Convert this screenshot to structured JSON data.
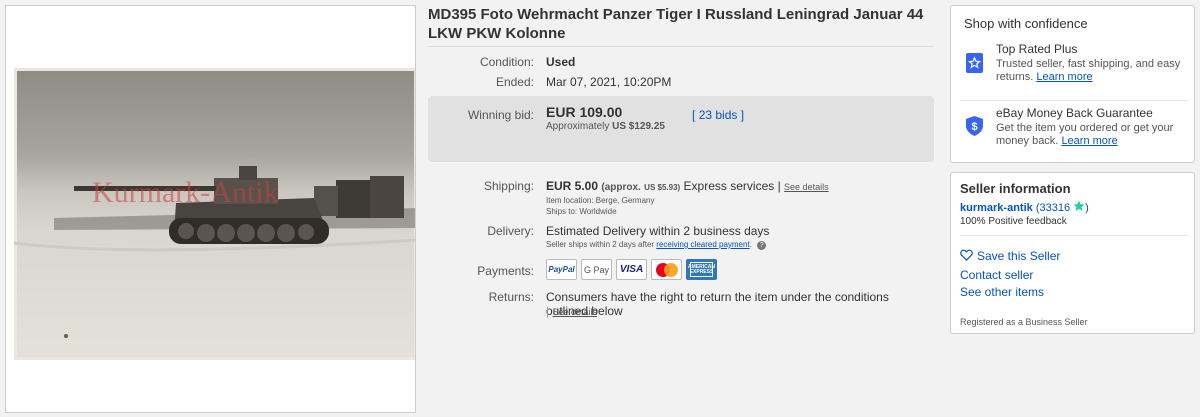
{
  "listing": {
    "title": "MD395 Foto Wehrmacht Panzer Tiger I Russland Leningrad Januar 44 LKW PKW Kolonne",
    "watermark": "Kurmark-Antik"
  },
  "details": {
    "condition_label": "Condition:",
    "condition_value": "Used",
    "ended_label": "Ended:",
    "ended_value": "Mar 07, 2021, 10:20PM",
    "winning_bid_label": "Winning bid:",
    "winning_bid_value": "EUR 109.00",
    "approx_label": "Approximately",
    "approx_value": "US $129.25",
    "bids_bracket_open": "[",
    "bids_link": "23 bids",
    "bids_bracket_close": "]"
  },
  "shipping": {
    "label": "Shipping:",
    "price": "EUR 5.00",
    "approx_open": "(approx.",
    "approx_value": "US $5.93)",
    "service": "Express services |",
    "see_details": "See details",
    "item_location": "Item location:  Berge, Germany",
    "ships_to": "Ships to:  Worldwide"
  },
  "delivery": {
    "label": "Delivery:",
    "estimate": "Estimated Delivery within 2 business days",
    "note_prefix": "Seller ships within 2 days after",
    "note_link": "receiving cleared payment",
    "note_suffix": "."
  },
  "payments": {
    "label": "Payments:",
    "methods": [
      "PayPal",
      "G Pay",
      "VISA",
      "Mastercard",
      "American Express"
    ]
  },
  "returns": {
    "label": "Returns:",
    "text": "Consumers have the right to return the item under the conditions outlined below",
    "see_details": "See details"
  },
  "confidence": {
    "title": "Shop with confidence",
    "top_rated_title": "Top Rated Plus",
    "top_rated_desc": "Trusted seller, fast shipping, and easy returns.",
    "top_rated_link": "Learn more",
    "guarantee_title": "eBay Money Back Guarantee",
    "guarantee_desc": "Get the item you ordered or get your money back.",
    "guarantee_link": "Learn more"
  },
  "seller": {
    "title": "Seller information",
    "name": "kurmark-antik",
    "score_open": "(",
    "score": "33316",
    "score_close": ")",
    "feedback": "100% Positive feedback",
    "save_seller": "Save this Seller",
    "contact": "Contact seller",
    "other_items": "See other items",
    "registered": "Registered as a Business Seller"
  },
  "colors": {
    "link": "#0654ba",
    "badge": "#3665f3",
    "star": "#1bd1a6",
    "watermark": "#d23c3c"
  }
}
